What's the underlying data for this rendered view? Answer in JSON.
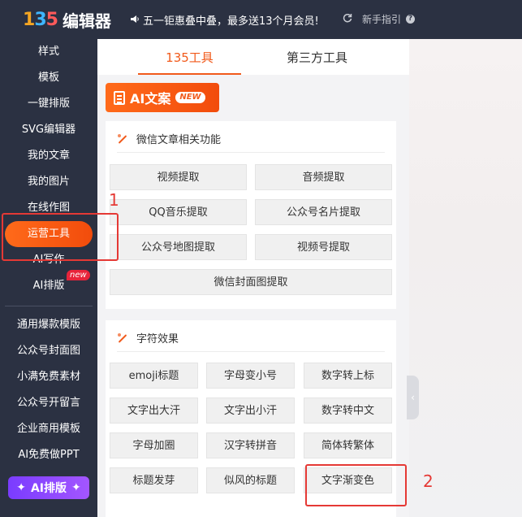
{
  "header": {
    "logo_mark": [
      "1",
      "3",
      "5"
    ],
    "logo_text": "编辑器",
    "promo_icon": "speaker-icon",
    "promo_text": "五一钜惠叠中叠，最多送13个月会员!",
    "guide_text": "新手指引",
    "guide_icon": "question-icon",
    "refresh_icon": "refresh-icon"
  },
  "sidebar": {
    "items": [
      {
        "label": "样式"
      },
      {
        "label": "模板"
      },
      {
        "label": "一键排版"
      },
      {
        "label": "SVG编辑器"
      },
      {
        "label": "我的文章"
      },
      {
        "label": "我的图片"
      },
      {
        "label": "在线作图"
      },
      {
        "label": "运营工具",
        "active": true
      },
      {
        "label": "AI写作"
      },
      {
        "label": "AI排版",
        "badge": "new"
      }
    ],
    "items2": [
      {
        "label": "通用爆款模版"
      },
      {
        "label": "公众号封面图"
      },
      {
        "label": "小满免费素材"
      },
      {
        "label": "公众号开留言"
      },
      {
        "label": "企业商用模板"
      },
      {
        "label": "AI免费做PPT"
      }
    ],
    "ai_button": "AI排版",
    "ai_button_icon": "sparkle-icon"
  },
  "tabs": {
    "tab1": "135工具",
    "tab2": "第三方工具"
  },
  "ai_copy": {
    "label": "AI文案",
    "badge": "NEW",
    "icon": "document-icon"
  },
  "section1": {
    "title": "微信文章相关功能",
    "buttons": [
      "视频提取",
      "音频提取",
      "QQ音乐提取",
      "公众号名片提取",
      "公众号地图提取",
      "视频号提取",
      "微信封面图提取"
    ]
  },
  "section2": {
    "title": "字符效果",
    "buttons": [
      "emoji标题",
      "字母变小号",
      "数字转上标",
      "文字出大汗",
      "文字出小汗",
      "数字转中文",
      "字母加圈",
      "汉字转拼音",
      "简体转繁体",
      "标题发芽",
      "似风的标题",
      "文字渐变色"
    ]
  },
  "annotations": {
    "label1": "1",
    "label2": "2",
    "color": "#e53935"
  },
  "colors": {
    "accent": "#f15a1b",
    "sidebar_bg": "#2b3142"
  }
}
